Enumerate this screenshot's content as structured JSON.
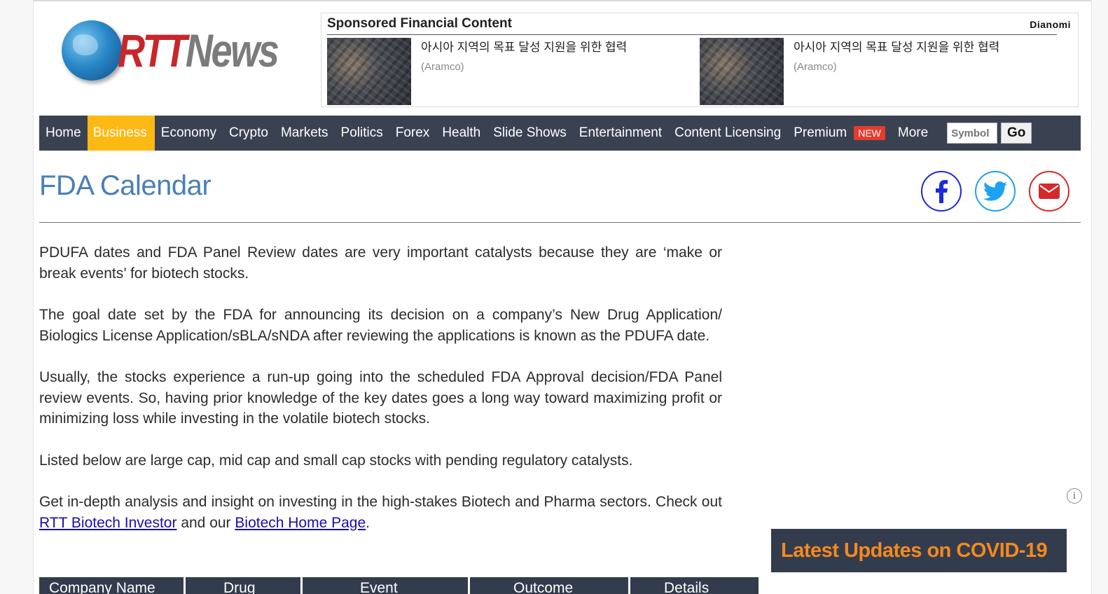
{
  "header": {
    "logo_rtt": "RTT",
    "logo_news": "News"
  },
  "sponsored": {
    "title": "Sponsored Financial Content",
    "brand": "Dianomi",
    "items": [
      {
        "text": "아시아 지역의 목표 달성 지원을 위한 협력",
        "source": "(Aramco)"
      },
      {
        "text": "아시아 지역의 목표 달성 지원을 위한 협력",
        "source": "(Aramco)"
      }
    ]
  },
  "nav": {
    "items": [
      "Home",
      "Business",
      "Economy",
      "Crypto",
      "Markets",
      "Politics",
      "Forex",
      "Health",
      "Slide Shows",
      "Entertainment",
      "Content Licensing",
      "Premium",
      "More"
    ],
    "active": "Business",
    "badge": "NEW",
    "symbol_placeholder": "Symbol",
    "go_label": "Go"
  },
  "page": {
    "title": "FDA Calendar"
  },
  "social": {
    "icons": [
      "facebook-icon",
      "twitter-icon",
      "email-icon"
    ],
    "colors": {
      "facebook": "#1c2bd6",
      "twitter": "#1da1f2",
      "email": "#d42a2a"
    }
  },
  "article": {
    "p1": "PDUFA dates and FDA Panel Review dates are very important catalysts because they are ‘make or break events’ for biotech stocks.",
    "p2": "The goal date set by the FDA for announcing its decision on a company’s New Drug Application/ Biologics License Application/sBLA/sNDA after reviewing the applications is known as the PDUFA date.",
    "p3": "Usually, the stocks experience a run-up going into the scheduled FDA Approval decision/FDA Panel review events. So, having prior knowledge of the key dates goes a long way toward maximizing profit or minimizing loss while investing in the volatile biotech stocks.",
    "p4": "Listed below are large cap, mid cap and small cap stocks with pending regulatory catalysts.",
    "p5_prefix": "Get in-depth analysis and insight on investing in the high-stakes Biotech and Pharma sectors. Check out ",
    "link1": "RTT Biotech Investor",
    "p5_mid": " and our ",
    "link2": "Biotech Home Page",
    "p5_suffix": "."
  },
  "sidebar": {
    "info_glyph": "i",
    "covid_label": "Latest Updates on COVID-19"
  },
  "table": {
    "headers": [
      "Company Name",
      "Drug",
      "Event",
      "Outcome",
      "Details"
    ]
  },
  "colors": {
    "nav_bg": "#3a4252",
    "nav_active": "#fdb913",
    "title": "#4a7fb5",
    "covid_text": "#f5891f",
    "link": "#1a0dab"
  }
}
